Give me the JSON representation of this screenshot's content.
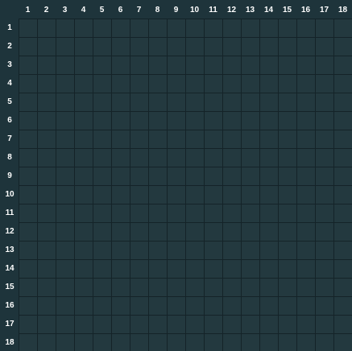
{
  "colors": {
    "cell": "#23393f",
    "grid_line": "#142328",
    "header_bg": "#1e343b",
    "label_text": "#ffffff"
  },
  "columns": [
    "1",
    "2",
    "3",
    "4",
    "5",
    "6",
    "7",
    "8",
    "9",
    "10",
    "11",
    "12",
    "13",
    "14",
    "15",
    "16",
    "17",
    "18"
  ],
  "rows": [
    "1",
    "2",
    "3",
    "4",
    "5",
    "6",
    "7",
    "8",
    "9",
    "10",
    "11",
    "12",
    "13",
    "14",
    "15",
    "16",
    "17",
    "18"
  ]
}
